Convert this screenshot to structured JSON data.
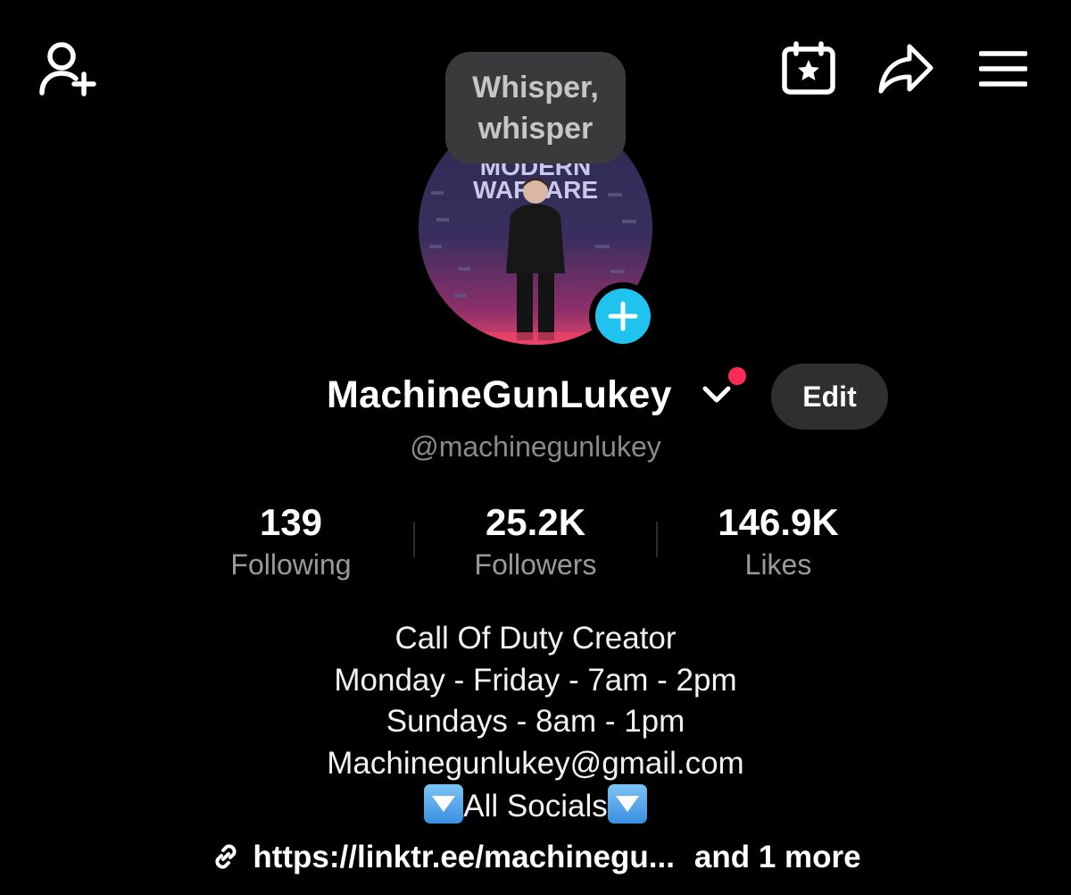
{
  "header": {
    "add_friend_icon": "person-plus-icon",
    "events_icon": "calendar-star-icon",
    "share_icon": "share-arrow-icon",
    "menu_icon": "hamburger-menu-icon"
  },
  "tooltip": {
    "line1": "Whisper,",
    "line2": "whisper"
  },
  "avatar": {
    "banner_line1": "MODERN",
    "banner_line2": "WARFARE",
    "plus_icon": "plus-icon",
    "plus_color": "#20c3ee"
  },
  "profile": {
    "display_name": "MachineGunLukey",
    "edit_label": "Edit",
    "handle": "@machinegunlukey",
    "notification_color": "#fe2c55"
  },
  "stats": [
    {
      "value": "139",
      "label": "Following"
    },
    {
      "value": "25.2K",
      "label": "Followers"
    },
    {
      "value": "146.9K",
      "label": "Likes"
    }
  ],
  "bio": {
    "line1": "Call Of Duty Creator",
    "line2": "Monday - Friday - 7am - 2pm",
    "line3": "Sundays - 8am - 1pm",
    "line4": "Machinegunlukey@gmail.com",
    "line5": "All Socials"
  },
  "link": {
    "url_text": "https://linktr.ee/machinegu...",
    "more_text": "and 1 more"
  }
}
